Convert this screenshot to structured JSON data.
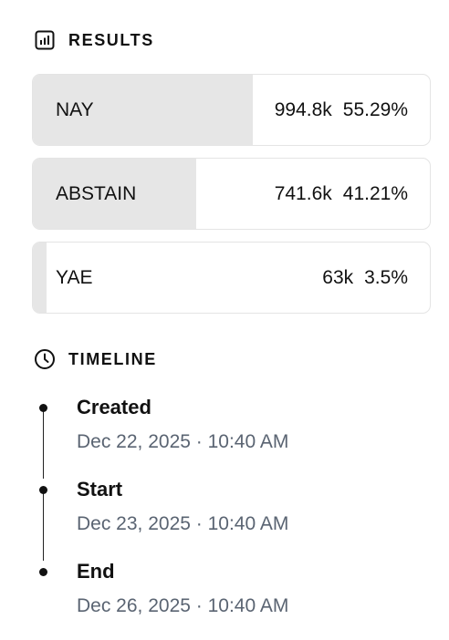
{
  "results": {
    "title": "RESULTS",
    "icon": "bar-chart-icon",
    "items": [
      {
        "label": "NAY",
        "votes": "994.8k",
        "percent_text": "55.29%",
        "percent": 55.29
      },
      {
        "label": "ABSTAIN",
        "votes": "741.6k",
        "percent_text": "41.21%",
        "percent": 41.21
      },
      {
        "label": "YAE",
        "votes": "63k",
        "percent_text": "3.5%",
        "percent": 3.5
      }
    ],
    "fill_color": "#e6e6e6"
  },
  "timeline": {
    "title": "TIMELINE",
    "icon": "clock-icon",
    "items": [
      {
        "label": "Created",
        "time": "Dec 22, 2025 · 10:40 AM"
      },
      {
        "label": "Start",
        "time": "Dec 23, 2025 · 10:40 AM"
      },
      {
        "label": "End",
        "time": "Dec 26, 2025 · 10:40 AM"
      }
    ]
  }
}
